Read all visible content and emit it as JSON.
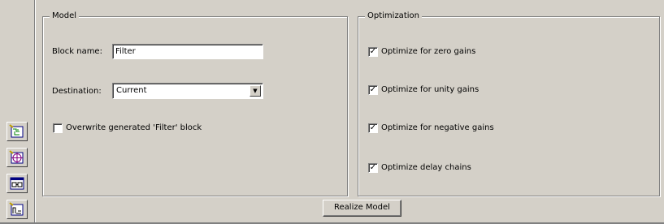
{
  "model_group": {
    "title": "Model",
    "block_name_label": "Block name:",
    "block_name_value": "Filter",
    "destination_label": "Destination:",
    "destination_value": "Current",
    "overwrite_label": "Overwrite generated 'Filter' block",
    "overwrite_checked": false
  },
  "optimization_group": {
    "title": "Optimization",
    "options": [
      {
        "label": "Optimize for zero gains",
        "checked": true
      },
      {
        "label": "Optimize for unity gains",
        "checked": true
      },
      {
        "label": "Optimize for negative gains",
        "checked": true
      },
      {
        "label": "Optimize delay chains",
        "checked": true
      }
    ]
  },
  "realize_button_label": "Realize Model",
  "sidebar_icons": [
    "filter-structure-icon",
    "pole-zero-icon",
    "realize-model-icon",
    "sidebar-tool-icon"
  ]
}
